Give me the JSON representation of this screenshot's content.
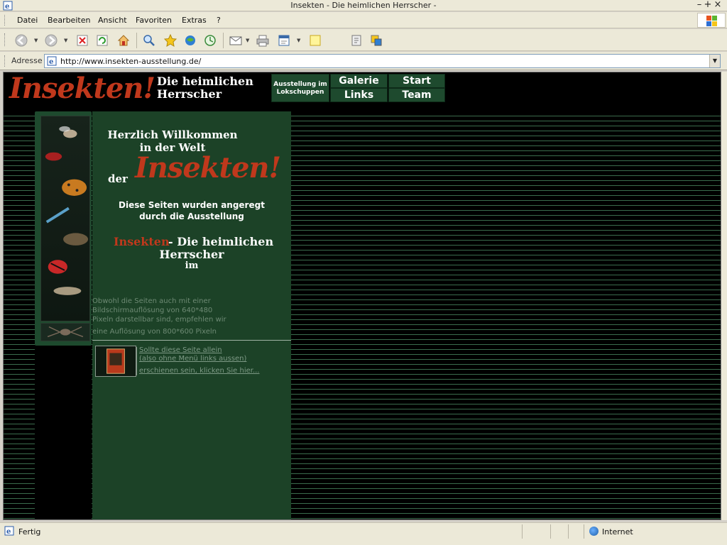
{
  "window": {
    "title": "Insekten - Die heimlichen Herrscher -",
    "minimize": "–",
    "maximize": "+",
    "close": "×"
  },
  "menu": {
    "items": [
      "Datei",
      "Bearbeiten",
      "Ansicht",
      "Favoriten",
      "Extras",
      "?"
    ]
  },
  "toolbar": {
    "icons": [
      "back-icon",
      "forward-icon",
      "stop-icon",
      "refresh-icon",
      "home-icon",
      "search-icon",
      "favorites-icon",
      "media-icon",
      "history-icon",
      "mail-icon",
      "print-icon",
      "edit-icon",
      "discuss-icon",
      "messenger-icon",
      "research-icon"
    ]
  },
  "address": {
    "label": "Adresse",
    "url": "http://www.insekten-ausstellung.de/"
  },
  "site": {
    "logo": "Insekten!",
    "subtitle_line1": "Die heimlichen",
    "subtitle_line2": "Herrscher",
    "nav": {
      "exhibition_line1": "Ausstellung im",
      "exhibition_line2": "Lokschuppen",
      "gallery": "Galerie",
      "links": "Links",
      "start": "Start",
      "team": "Team"
    }
  },
  "content": {
    "welcome_line1": "Herzlich Willkommen",
    "welcome_line2": "in der Welt",
    "der": "der",
    "insekten": "Insekten!",
    "inspired_line1": "Diese Seiten wurden angeregt",
    "inspired_line2": "durch die Ausstellung",
    "exhibit_red": "Insekten",
    "exhibit_rest": "- Die heimlichen",
    "exhibit_line2": "Herrscher",
    "exhibit_im": "im",
    "resolution_lines": [
      "Obwohl die Seiten auch mit einer",
      "Bildschirmauflösung von 640*480",
      "Pixeln darstellbar sind, empfehlen wir",
      "eine Auflösung von 800*600 Pixeln"
    ],
    "link_line1": "Sollte diese Seite allein",
    "link_line2": "(also ohne Menü links aussen)",
    "link_line3": "erschienen sein, klicken Sie hier..."
  },
  "status": {
    "text": "Fertig",
    "zone": "Internet"
  },
  "colors": {
    "accent_red": "#c0381c",
    "panel_green": "#1c4227",
    "nav_green": "#1e4a2e"
  }
}
